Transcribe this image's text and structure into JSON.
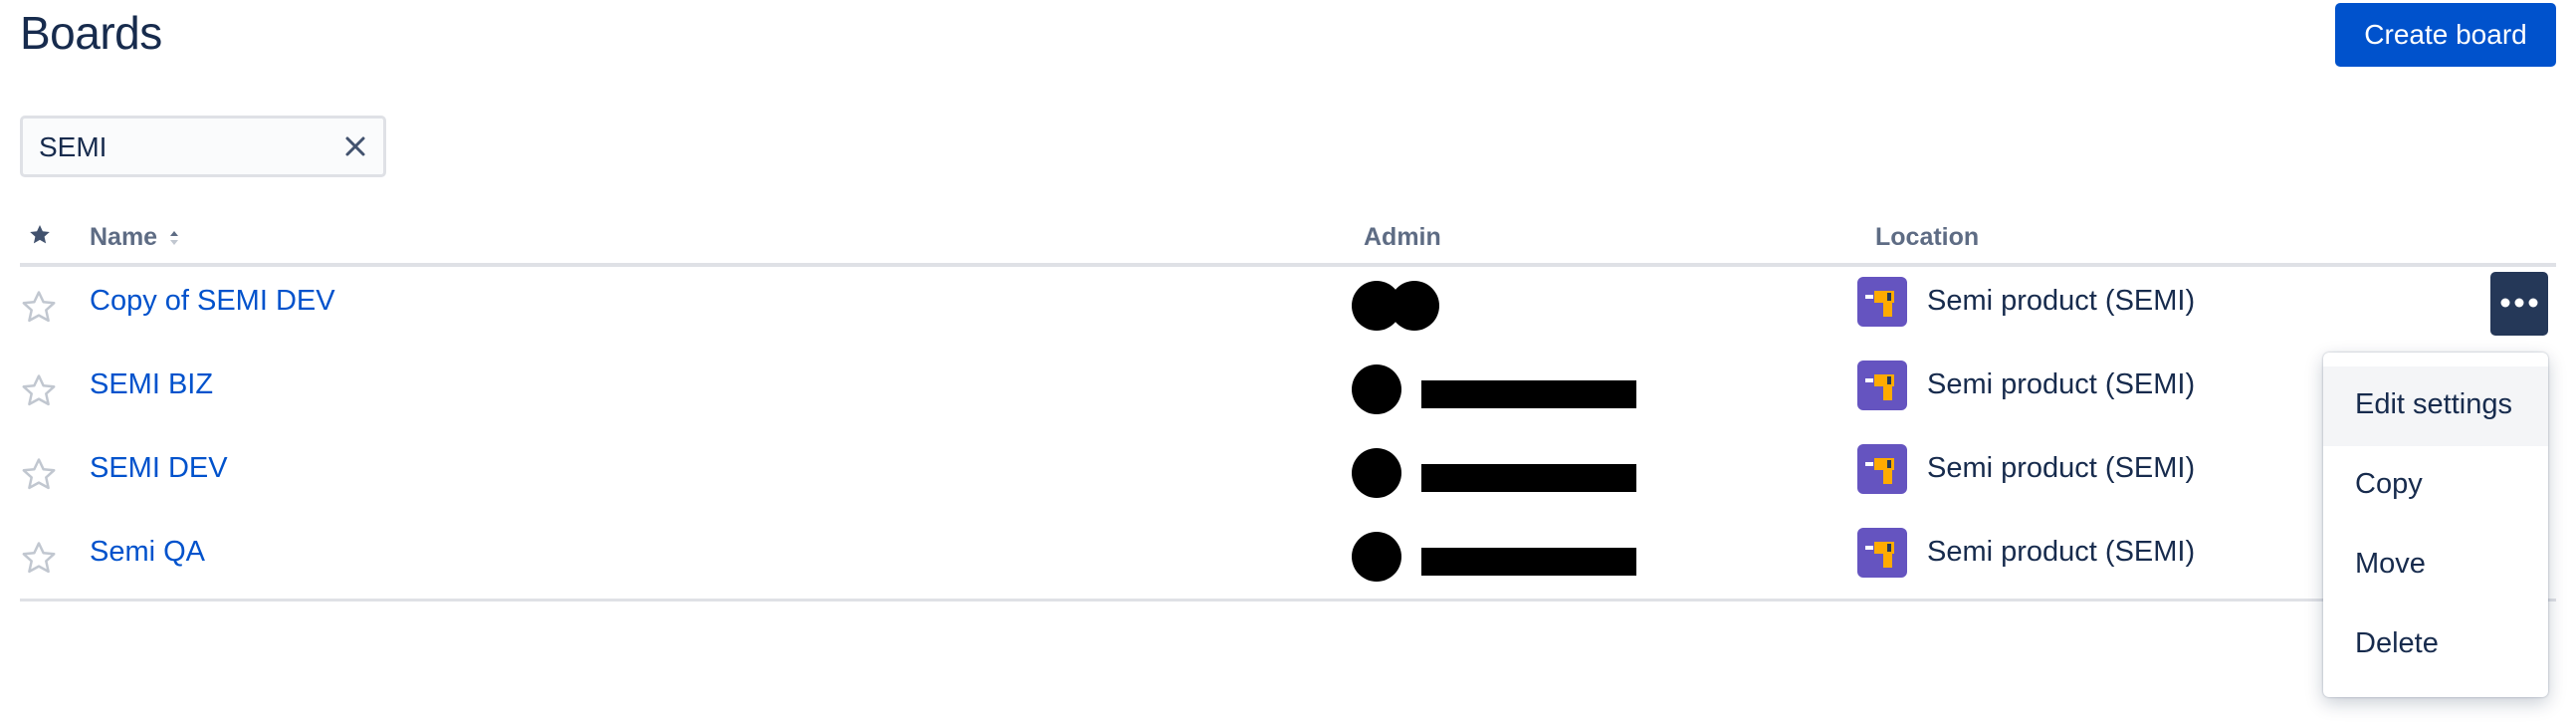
{
  "page": {
    "title": "Boards"
  },
  "toolbar": {
    "create_label": "Create board"
  },
  "search": {
    "value": "SEMI",
    "placeholder": ""
  },
  "table": {
    "columns": {
      "name": "Name",
      "admin": "Admin",
      "location": "Location"
    },
    "sort": {
      "column": "name",
      "direction": "ascending"
    },
    "rows": [
      {
        "name": "Copy of SEMI DEV",
        "location": "Semi product (SEMI)",
        "starred": false
      },
      {
        "name": "SEMI BIZ",
        "location": "Semi product (SEMI)",
        "starred": false
      },
      {
        "name": "SEMI DEV",
        "location": "Semi product (SEMI)",
        "starred": false
      },
      {
        "name": "Semi QA",
        "location": "Semi product (SEMI)",
        "starred": false
      }
    ]
  },
  "row_menu": {
    "items": [
      {
        "label": "Edit settings"
      },
      {
        "label": "Copy"
      },
      {
        "label": "Move"
      },
      {
        "label": "Delete"
      }
    ]
  },
  "colors": {
    "primary": "#0052cc",
    "heading": "#172b4d",
    "subtle": "#5e6c84",
    "border": "#dfe1e6",
    "project_icon_bg": "#6554c0",
    "project_icon_accent": "#ffab00",
    "more_button_bg": "#253858"
  },
  "icons": {
    "star_header": "star-filled-icon",
    "row_star": "star-outline-icon",
    "clear": "close-icon",
    "sort": "sort-ascending-icon",
    "more": "more-horizontal-icon",
    "project": "project-drill-icon"
  }
}
